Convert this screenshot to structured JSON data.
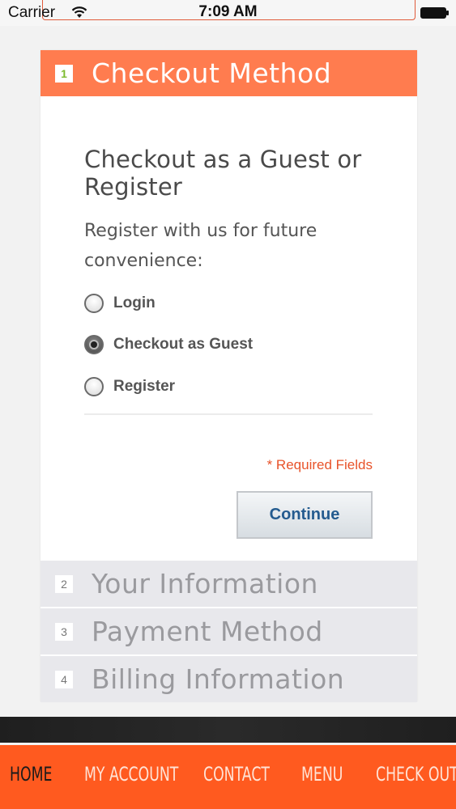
{
  "status_bar": {
    "carrier": "Carrier",
    "time": "7:09 AM",
    "icons": [
      "wifi-icon",
      "battery-icon"
    ]
  },
  "checkout": {
    "accent_color": "#ff7c4f",
    "steps": [
      {
        "number": "1",
        "title": "Checkout Method",
        "active": true
      },
      {
        "number": "2",
        "title": "Your Information",
        "active": false
      },
      {
        "number": "3",
        "title": "Payment Method",
        "active": false
      },
      {
        "number": "4",
        "title": "Billing Information",
        "active": false
      }
    ],
    "heading": "Checkout as a Guest or Register",
    "description": "Register with us for future convenience:",
    "options": [
      {
        "label": "Login",
        "selected": false
      },
      {
        "label": "Checkout as Guest",
        "selected": true
      },
      {
        "label": "Register",
        "selected": false
      }
    ],
    "required_note": "* Required Fields",
    "continue_label": "Continue"
  },
  "bottom_nav": {
    "color": "#ff5a1f",
    "items": [
      {
        "label": "HOME",
        "active": true
      },
      {
        "label": "MY ACCOUNT",
        "active": false
      },
      {
        "label": "CONTACT",
        "active": false
      },
      {
        "label": "MENU",
        "active": false
      },
      {
        "label": "CHECK OUT",
        "active": false
      }
    ]
  }
}
